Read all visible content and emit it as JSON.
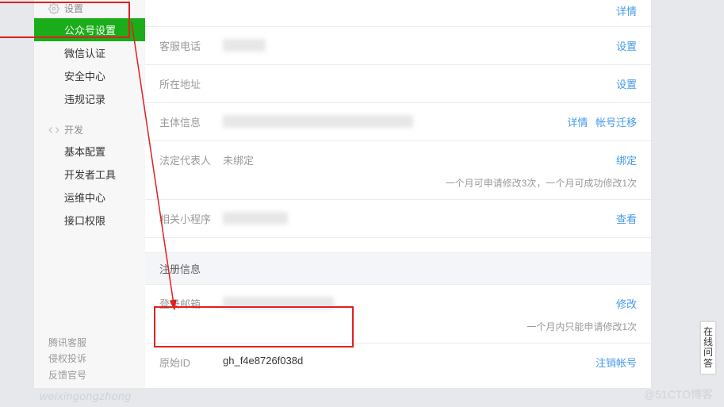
{
  "sidebar": {
    "groups": [
      {
        "icon": "gear",
        "title": "设置",
        "items": [
          "公众号设置",
          "微信认证",
          "安全中心",
          "违规记录"
        ],
        "activeIndex": 0
      },
      {
        "icon": "code",
        "title": "开发",
        "items": [
          "基本配置",
          "开发者工具",
          "运维中心",
          "接口权限"
        ],
        "activeIndex": -1
      }
    ],
    "footer": [
      "腾讯客服",
      "侵权投诉",
      "反馈官号"
    ]
  },
  "rows": {
    "detail_top": {
      "action": "详情"
    },
    "hotline": {
      "label": "客服电话",
      "action": "设置"
    },
    "address": {
      "label": "所在地址",
      "action": "设置"
    },
    "entity": {
      "label": "主体信息",
      "action1": "详情",
      "action2": "帐号迁移"
    },
    "legal": {
      "label": "法定代表人",
      "value": "未绑定",
      "action": "绑定",
      "note": "一个月可申请修改3次，一个月可成功修改1次"
    },
    "miniapp": {
      "label": "相关小程序",
      "action": "查看"
    },
    "reg_section": "注册信息",
    "email": {
      "label": "登录邮箱",
      "action": "修改",
      "note": "一个月内只能申请修改1次"
    },
    "origid": {
      "label": "原始ID",
      "value": "gh_f4e8726f038d",
      "action": "注销帐号"
    }
  },
  "widget": {
    "label": "在线问答"
  },
  "watermark": {
    "a": "weixingongzhong",
    "b": "@51CTO博客"
  }
}
